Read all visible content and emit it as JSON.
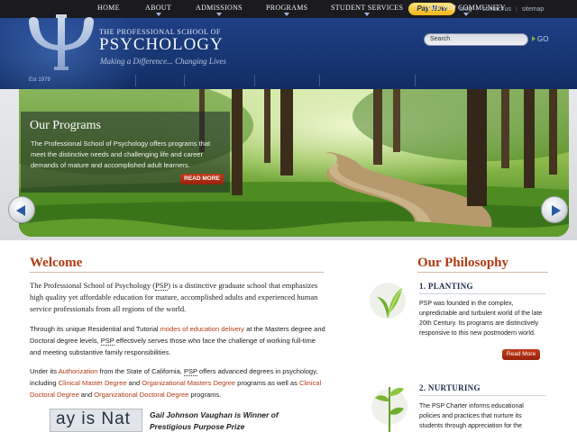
{
  "topbar": {
    "pay_now": "Pay Now",
    "links": [
      "blog",
      "contact us",
      "sitemap"
    ]
  },
  "header": {
    "est": "Est 1979",
    "school_small": "THE PROFESSIONAL SCHOOL OF",
    "school_big": "PSYCHOLOGY",
    "tagline": "Making a Difference... Changing Lives",
    "search_placeholder": "Search",
    "go_label": "GO"
  },
  "nav": {
    "items": [
      "HOME",
      "ABOUT",
      "ADMISSIONS",
      "PROGRAMS",
      "STUDENT SERVICES",
      "THE PSP COMMUNITY"
    ]
  },
  "hero": {
    "title": "Our Programs",
    "text": "The Professional School of Psychology offers programs that meet the distinctive needs and challenging life and career demands of mature and accomplished adult learners.",
    "read_more": "READ MORE"
  },
  "welcome": {
    "title": "Welcome",
    "p1_a": "The Professional School of Psychology (",
    "p1_abbr": "PSP",
    "p1_b": ") is a distinctive graduate school that emphasizes high quality yet affordable education for mature, accomplished adults and experienced human service professionals from all regions of the world.",
    "p2_a": "Through its unique Residential and Tutorial ",
    "p2_link": "modes of education delivery",
    "p2_b": " at the Masters degree and Doctoral degree levels, ",
    "p2_abbr": "PSP",
    "p2_c": " effectively serves those who face the challenge of working full-time and meeting substantive family responsibilities.",
    "p3_a": "Under its ",
    "p3_link1": "Authorization",
    "p3_b": " from the State of California, ",
    "p3_abbr": "PSP",
    "p3_c": " offers advanced degrees in psychology, including ",
    "p3_link2": "Clinical Master Degree",
    "p3_d": " and ",
    "p3_link3": "Organizational Masters Degree",
    "p3_e": " programs as well as ",
    "p3_link4": "Clinical Doctoral Degree",
    "p3_f": " and ",
    "p3_link5": "Organizational Doctoral Degree",
    "p3_g": " programs.",
    "news_image_text": "ay is Nat",
    "news_title": "Gail Johnson Vaughan is Winner of Prestigious Purpose Prize"
  },
  "philosophy": {
    "title": "Our Philosophy",
    "sections": [
      {
        "title": "1. PLANTING",
        "text": "PSP was founded in the complex, unpredictable and turbulent world of the late 20th Century. Its programs are distinctively responsive to this new postmodern world.",
        "read_more": "Read More"
      },
      {
        "title": "2. NURTURING",
        "text": "The PSP Charter informs educational policies and practices that nurture its students through appreciation for the"
      }
    ]
  },
  "colors": {
    "accent": "#b13b12",
    "header_blue": "#173672",
    "button_red": "#b02e12",
    "pay_now_gold": "#f5b417"
  }
}
